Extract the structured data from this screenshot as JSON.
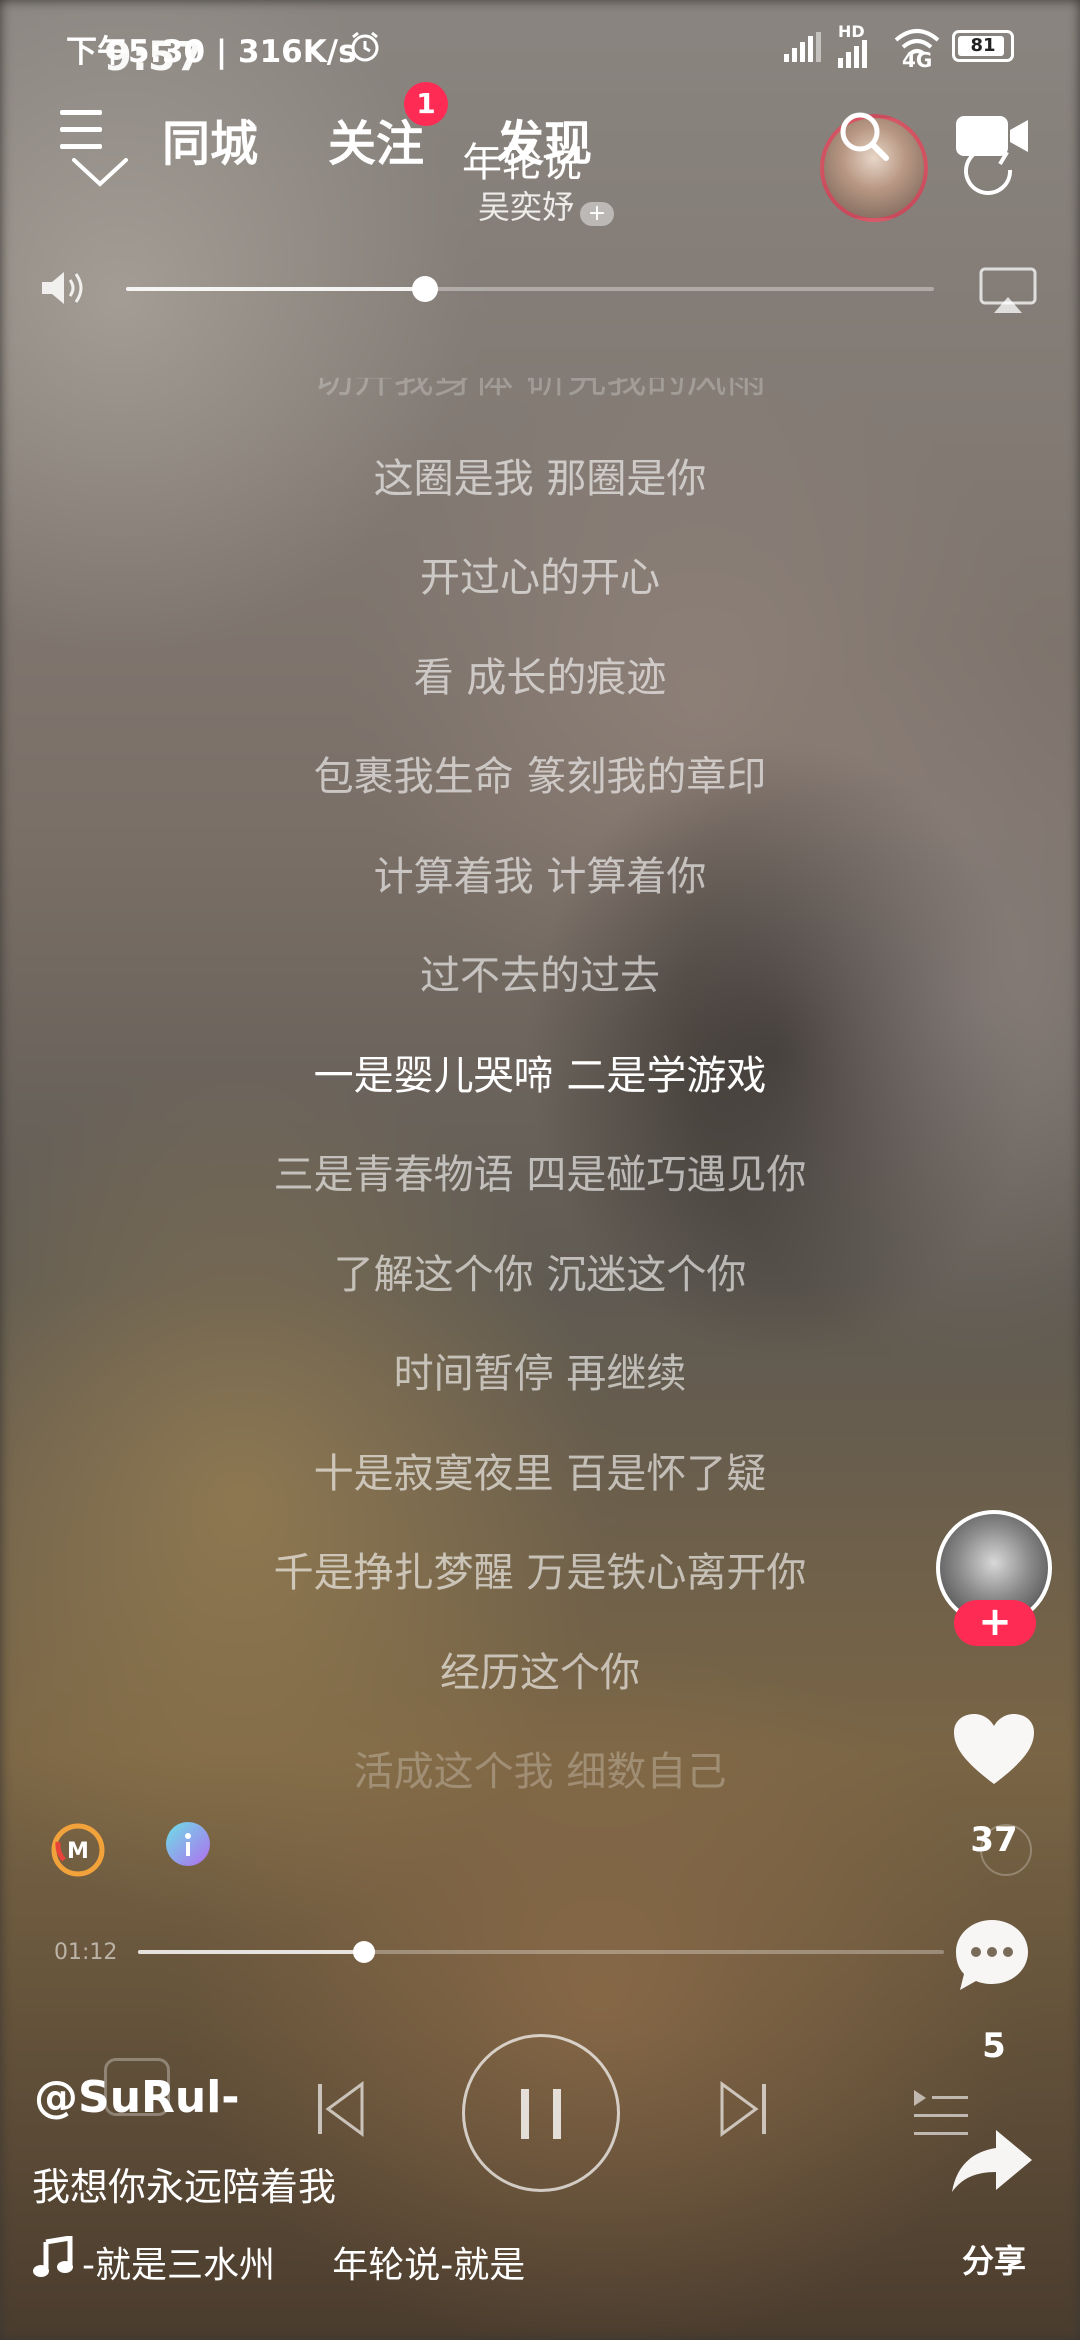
{
  "status_bar": {
    "left_text": "下午5:30 | 316K/s",
    "overlay_time": "9:57",
    "network": "4G",
    "battery": "81",
    "hd_label": "HD"
  },
  "top_nav": {
    "tabs": [
      "同城",
      "关注",
      "发现"
    ],
    "follow_badge": "1"
  },
  "song": {
    "title": "年轮说",
    "artist": "吴奕妤",
    "artist_follow": "+"
  },
  "volume": {
    "level": 0.37
  },
  "lyrics": {
    "lines": [
      "切开我身体 研究我的风雨",
      "这圈是我 那圈是你",
      "开过心的开心",
      "看 成长的痕迹",
      "包裹我生命 篆刻我的章印",
      "计算着我 计算着你",
      "过不去的过去",
      "一是婴儿哭啼 二是学游戏",
      "三是青春物语 四是碰巧遇见你",
      "了解这个你 沉迷这个你",
      "时间暂停 再继续",
      "十是寂寞夜里 百是怀了疑",
      "千是挣扎梦醒 万是铁心离开你",
      "经历这个你",
      "活成这个我 细数自己"
    ],
    "current_index": 7
  },
  "progress": {
    "elapsed": "01:12",
    "fraction": 0.28
  },
  "right_column": {
    "like_count": "37",
    "comment_count": "5",
    "share_label": "分享",
    "follow_plus": "+"
  },
  "bottom_info": {
    "username": "@SuRul-",
    "caption": "我想你永远陪着我",
    "music": "-就是三水州     年轮说-就是"
  },
  "icons": {
    "menu": "menu-icon",
    "search": "search-icon",
    "video": "video-camera-icon",
    "volume": "speaker-icon",
    "airplay": "airplay-icon",
    "like": "heart-icon",
    "comment": "comment-icon",
    "share": "share-arrow-icon",
    "music": "music-note-icon"
  },
  "colors": {
    "badge": "#fe2c55",
    "follow_button": "#fe2c55",
    "lyric_current": "#ffffff",
    "lyric_other": "rgba(255,255,255,0.6)"
  }
}
